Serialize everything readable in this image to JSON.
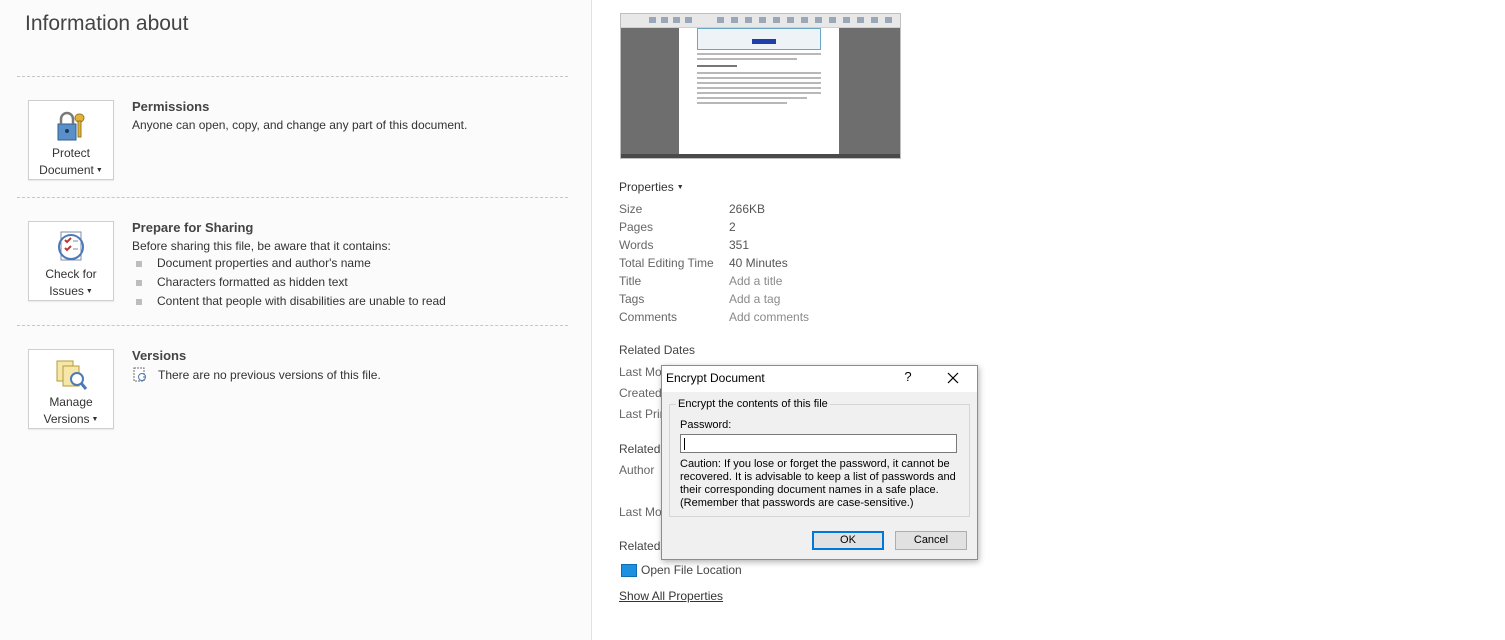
{
  "info": {
    "title": "Information about"
  },
  "permissions": {
    "button_line1": "Protect",
    "button_line2": "Document",
    "title": "Permissions",
    "description": "Anyone can open, copy, and change any part of this document."
  },
  "sharing": {
    "button_line1": "Check for",
    "button_line2": "Issues",
    "title": "Prepare for Sharing",
    "description": "Before sharing this file, be aware that it contains:",
    "items": [
      "Document properties and author's name",
      "Characters formatted as hidden text",
      "Content that people with disabilities are unable to read"
    ]
  },
  "versions": {
    "button_line1": "Manage",
    "button_line2": "Versions",
    "title": "Versions",
    "description": "There are no previous versions of this file."
  },
  "properties": {
    "header": "Properties",
    "rows": [
      {
        "key": "Size",
        "value": "266KB"
      },
      {
        "key": "Pages",
        "value": "2"
      },
      {
        "key": "Words",
        "value": "351"
      },
      {
        "key": "Total Editing Time",
        "value": "40 Minutes"
      },
      {
        "key": "Title",
        "value": "Add a title"
      },
      {
        "key": "Tags",
        "value": "Add a tag"
      },
      {
        "key": "Comments",
        "value": "Add comments"
      }
    ]
  },
  "related_dates": {
    "header": "Related Dates",
    "labels": [
      "Last Mo",
      "Created",
      "Last Prin"
    ]
  },
  "related_people": {
    "header": "Related",
    "author_label": "Author",
    "last_modified_label": "Last Mo"
  },
  "related_docs": {
    "header": "Related",
    "open_location": "Open File Location",
    "show_all": "Show All Properties"
  },
  "dialog": {
    "title": "Encrypt Document",
    "help": "?",
    "group_label": "Encrypt the contents of this file",
    "password_label": "Password:",
    "password_value": "",
    "caution": "Caution: If you lose or forget the password, it cannot be recovered. It is advisable to keep a list of passwords and their corresponding document names in a safe place. (Remember that passwords are case-sensitive.)",
    "ok": "OK",
    "cancel": "Cancel"
  },
  "colors": {
    "dialog_bg": "#f0f0f0",
    "ok_border": "#0078d7",
    "folder_icon": "#1e90e0"
  }
}
